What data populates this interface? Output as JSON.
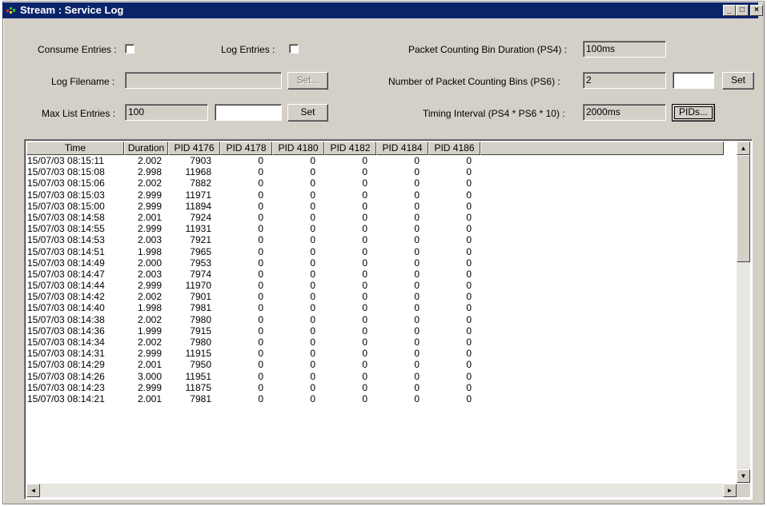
{
  "window": {
    "title": "Stream : Service Log",
    "controls": {
      "minimize": "_",
      "maximize": "□",
      "close": "×"
    }
  },
  "settings": {
    "consume_entries_label": "Consume Entries :",
    "log_entries_label": "Log Entries :",
    "log_filename_label": "Log Filename :",
    "log_filename_value": "",
    "log_filename_set": "Set...",
    "max_list_entries_label": "Max List Entries :",
    "max_list_entries_value": "100",
    "max_list_entries_input": "",
    "max_list_entries_set": "Set",
    "bin_duration_label": "Packet Counting Bin Duration (PS4) :",
    "bin_duration_value": "100ms",
    "bin_count_label": "Number of Packet Counting Bins (PS6) :",
    "bin_count_value": "2",
    "bin_count_input": "",
    "bin_count_set": "Set",
    "timing_interval_label": "Timing Interval (PS4 * PS6 * 10) :",
    "timing_interval_value": "2000ms",
    "pids_button": "PIDs..."
  },
  "table": {
    "columns": [
      "Time",
      "Duration",
      "PID 4176",
      "PID 4178",
      "PID 4180",
      "PID 4182",
      "PID 4184",
      "PID 4186"
    ],
    "rows": [
      [
        "15/07/03 08:15:11",
        "2.002",
        "7903",
        "0",
        "0",
        "0",
        "0",
        "0"
      ],
      [
        "15/07/03 08:15:08",
        "2.998",
        "11968",
        "0",
        "0",
        "0",
        "0",
        "0"
      ],
      [
        "15/07/03 08:15:06",
        "2.002",
        "7882",
        "0",
        "0",
        "0",
        "0",
        "0"
      ],
      [
        "15/07/03 08:15:03",
        "2.999",
        "11971",
        "0",
        "0",
        "0",
        "0",
        "0"
      ],
      [
        "15/07/03 08:15:00",
        "2.999",
        "11894",
        "0",
        "0",
        "0",
        "0",
        "0"
      ],
      [
        "15/07/03 08:14:58",
        "2.001",
        "7924",
        "0",
        "0",
        "0",
        "0",
        "0"
      ],
      [
        "15/07/03 08:14:55",
        "2.999",
        "11931",
        "0",
        "0",
        "0",
        "0",
        "0"
      ],
      [
        "15/07/03 08:14:53",
        "2.003",
        "7921",
        "0",
        "0",
        "0",
        "0",
        "0"
      ],
      [
        "15/07/03 08:14:51",
        "1.998",
        "7965",
        "0",
        "0",
        "0",
        "0",
        "0"
      ],
      [
        "15/07/03 08:14:49",
        "2.000",
        "7953",
        "0",
        "0",
        "0",
        "0",
        "0"
      ],
      [
        "15/07/03 08:14:47",
        "2.003",
        "7974",
        "0",
        "0",
        "0",
        "0",
        "0"
      ],
      [
        "15/07/03 08:14:44",
        "2.999",
        "11970",
        "0",
        "0",
        "0",
        "0",
        "0"
      ],
      [
        "15/07/03 08:14:42",
        "2.002",
        "7901",
        "0",
        "0",
        "0",
        "0",
        "0"
      ],
      [
        "15/07/03 08:14:40",
        "1.998",
        "7981",
        "0",
        "0",
        "0",
        "0",
        "0"
      ],
      [
        "15/07/03 08:14:38",
        "2.002",
        "7980",
        "0",
        "0",
        "0",
        "0",
        "0"
      ],
      [
        "15/07/03 08:14:36",
        "1.999",
        "7915",
        "0",
        "0",
        "0",
        "0",
        "0"
      ],
      [
        "15/07/03 08:14:34",
        "2.002",
        "7980",
        "0",
        "0",
        "0",
        "0",
        "0"
      ],
      [
        "15/07/03 08:14:31",
        "2.999",
        "11915",
        "0",
        "0",
        "0",
        "0",
        "0"
      ],
      [
        "15/07/03 08:14:29",
        "2.001",
        "7950",
        "0",
        "0",
        "0",
        "0",
        "0"
      ],
      [
        "15/07/03 08:14:26",
        "3.000",
        "11951",
        "0",
        "0",
        "0",
        "0",
        "0"
      ],
      [
        "15/07/03 08:14:23",
        "2.999",
        "11875",
        "0",
        "0",
        "0",
        "0",
        "0"
      ],
      [
        "15/07/03 08:14:21",
        "2.001",
        "7981",
        "0",
        "0",
        "0",
        "0",
        "0"
      ]
    ]
  },
  "scrollbars": {
    "up": "▲",
    "down": "▼",
    "left": "◄",
    "right": "►"
  },
  "colors": {
    "titlebar": "#0a246a",
    "face": "#d4d0c8"
  }
}
